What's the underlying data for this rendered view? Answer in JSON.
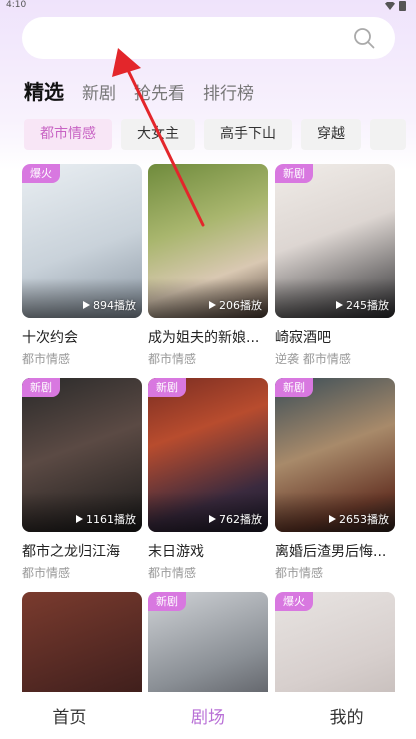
{
  "status": {
    "time": "4:10"
  },
  "search": {
    "placeholder": ""
  },
  "tabs": [
    "精选",
    "新剧",
    "抢先看",
    "排行榜"
  ],
  "chips": [
    "都市情感",
    "大女主",
    "高手下山",
    "穿越"
  ],
  "cards": [
    {
      "title": "十次约会",
      "tags": "都市情感",
      "badge": "爆火",
      "plays": "894播放"
    },
    {
      "title": "成为姐夫的新娘...",
      "tags": "都市情感",
      "badge": "",
      "plays": "206播放"
    },
    {
      "title": "崎寂酒吧",
      "tags": "逆袭 都市情感",
      "badge": "新剧",
      "plays": "245播放"
    },
    {
      "title": "都市之龙归江海",
      "tags": "都市情感",
      "badge": "新剧",
      "plays": "1161播放"
    },
    {
      "title": "末日游戏",
      "tags": "都市情感",
      "badge": "新剧",
      "plays": "762播放"
    },
    {
      "title": "离婚后渣男后悔...",
      "tags": "都市情感",
      "badge": "新剧",
      "plays": "2653播放"
    },
    {
      "title": "",
      "tags": "",
      "badge": "",
      "plays": ""
    },
    {
      "title": "",
      "tags": "",
      "badge": "新剧",
      "plays": ""
    },
    {
      "title": "",
      "tags": "",
      "badge": "爆火",
      "plays": ""
    }
  ],
  "nav": [
    "首页",
    "剧场",
    "我的"
  ],
  "colors": {
    "accent": "#b86fd6",
    "badge": "#d878e0",
    "chip_active_text": "#c864c4",
    "annotation": "#e3262b"
  }
}
